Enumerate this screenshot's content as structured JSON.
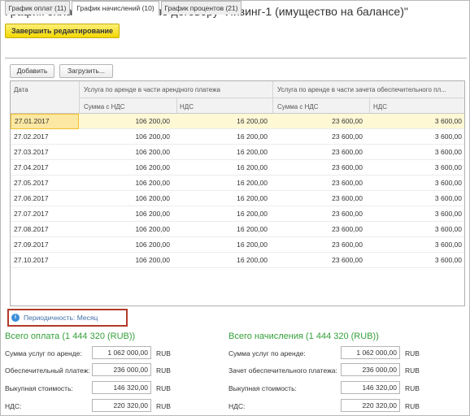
{
  "title": "График оплат и начислений по договору \"Лизинг-1 (имущество на балансе)\"",
  "finish_button": "Завершить редактирование",
  "tabs": [
    {
      "label": "График оплат (11)",
      "active": false
    },
    {
      "label": "График начислений (10)",
      "active": true
    },
    {
      "label": "График процентов (21)",
      "active": false
    }
  ],
  "toolbar": {
    "add_label": "Добавить",
    "load_label": "Загрузить..."
  },
  "table": {
    "date_header": "Дата",
    "group1_header": "Услуга по аренде в части арендного платежа",
    "group2_header": "Услуга по аренде в части зачета обеспечительного пл...",
    "sub_headers": [
      "Сумма с НДС",
      "НДС",
      "Сумма с НДС",
      "НДС"
    ],
    "rows": [
      {
        "date": "27.01.2017",
        "amount1": "106 200,00",
        "vat1": "16 200,00",
        "amount2": "23 600,00",
        "vat2": "3 600,00"
      },
      {
        "date": "27.02.2017",
        "amount1": "106 200,00",
        "vat1": "16 200,00",
        "amount2": "23 600,00",
        "vat2": "3 600,00"
      },
      {
        "date": "27.03.2017",
        "amount1": "106 200,00",
        "vat1": "16 200,00",
        "amount2": "23 600,00",
        "vat2": "3 600,00"
      },
      {
        "date": "27.04.2017",
        "amount1": "106 200,00",
        "vat1": "16 200,00",
        "amount2": "23 600,00",
        "vat2": "3 600,00"
      },
      {
        "date": "27.05.2017",
        "amount1": "106 200,00",
        "vat1": "16 200,00",
        "amount2": "23 600,00",
        "vat2": "3 600,00"
      },
      {
        "date": "27.06.2017",
        "amount1": "106 200,00",
        "vat1": "16 200,00",
        "amount2": "23 600,00",
        "vat2": "3 600,00"
      },
      {
        "date": "27.07.2017",
        "amount1": "106 200,00",
        "vat1": "16 200,00",
        "amount2": "23 600,00",
        "vat2": "3 600,00"
      },
      {
        "date": "27.08.2017",
        "amount1": "106 200,00",
        "vat1": "16 200,00",
        "amount2": "23 600,00",
        "vat2": "3 600,00"
      },
      {
        "date": "27.09.2017",
        "amount1": "106 200,00",
        "vat1": "16 200,00",
        "amount2": "23 600,00",
        "vat2": "3 600,00"
      },
      {
        "date": "27.10.2017",
        "amount1": "106 200,00",
        "vat1": "16 200,00",
        "amount2": "23 600,00",
        "vat2": "3 600,00"
      }
    ]
  },
  "periodicity": {
    "label": "Периодичность: Месяц",
    "icon": "info-icon"
  },
  "payments": {
    "title": "Всего оплата (1 444 320 (RUB))",
    "fields": [
      {
        "label": "Сумма услуг по аренде:",
        "value": "1 062 000,00",
        "currency": "RUB"
      },
      {
        "label": "Обеспечительный платеж:",
        "value": "236 000,00",
        "currency": "RUB"
      },
      {
        "label": "Выкупная стоимость:",
        "value": "146 320,00",
        "currency": "RUB"
      },
      {
        "label": "НДС:",
        "value": "220 320,00",
        "currency": "RUB"
      }
    ]
  },
  "accruals": {
    "title": "Всего начисления (1 444 320 (RUB))",
    "fields": [
      {
        "label": "Сумма услуг по аренде:",
        "value": "1 062 000,00",
        "currency": "RUB"
      },
      {
        "label": "Зачет обеспечительного платежа:",
        "value": "236 000,00",
        "currency": "RUB"
      },
      {
        "label": "Выкупная стоимость:",
        "value": "146 320,00",
        "currency": "RUB"
      },
      {
        "label": "НДС:",
        "value": "220 320,00",
        "currency": "RUB"
      }
    ]
  },
  "colors": {
    "accent_yellow": "#f3d800",
    "green_title": "#35a03b",
    "highlight_border": "#b23a2a",
    "selected_row": "#fff8d5"
  }
}
